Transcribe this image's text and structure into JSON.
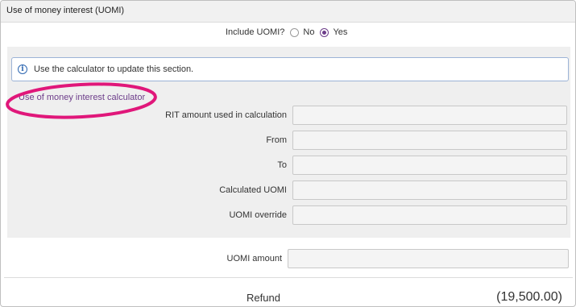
{
  "section": {
    "title": "Use of money interest (UOMI)"
  },
  "include": {
    "question": "Include UOMI?",
    "options": [
      "No",
      "Yes"
    ],
    "selected": "Yes"
  },
  "info": {
    "icon": "info-icon",
    "message": "Use the calculator to update this section."
  },
  "calculator": {
    "link_label": "Use of money interest calculator",
    "highlight_color": "#e0177a",
    "fields": [
      {
        "label": "RIT amount used in calculation",
        "value": ""
      },
      {
        "label": "From",
        "value": ""
      },
      {
        "label": "To",
        "value": ""
      },
      {
        "label": "Calculated UOMI",
        "value": ""
      },
      {
        "label": "UOMI override",
        "value": ""
      }
    ]
  },
  "uomi_amount": {
    "label": "UOMI amount",
    "value": ""
  },
  "refund": {
    "label": "Refund",
    "value": "(19,500.00)"
  },
  "colors": {
    "accent": "#6d3d8a",
    "info_border": "#9cb3d6",
    "panel_bg": "#efefef"
  }
}
